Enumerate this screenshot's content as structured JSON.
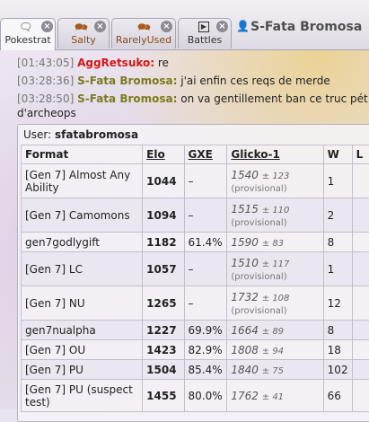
{
  "tabs": [
    {
      "label": "Pokestrat",
      "icon": "chat-bubble-icon"
    },
    {
      "label": "Salty",
      "icon": "chat-bubbles-icon"
    },
    {
      "label": "RarelyUsed",
      "icon": "chat-bubbles-icon"
    },
    {
      "label": "Battles",
      "icon": "battle-icon"
    }
  ],
  "close_label": "×",
  "user": {
    "name": "S-Fata Bromosa"
  },
  "chat": [
    {
      "time": "[01:43:05]",
      "nick": "AggRetsuko:",
      "text": "re"
    },
    {
      "time": "[03:28:36]",
      "nick": "S-Fata Bromosa:",
      "text": "j'ai enfin ces reqs de merde"
    },
    {
      "time": "[03:28:50]",
      "nick": "S-Fata Bromosa:",
      "text": "on va gentillement ban ce truc pét",
      "continuation": "d'archeops"
    }
  ],
  "panel": {
    "user_label": "User:",
    "user_value": "sfatabromosa",
    "headers": [
      "Format",
      "Elo",
      "GXE",
      "Glicko-1",
      "W",
      "L"
    ],
    "rows": [
      {
        "format": "[Gen 7] Almost Any Ability",
        "elo": "1044",
        "gxe": "–",
        "glicko": "1540",
        "pm": "± 123",
        "prov": "(provisional)",
        "w": "1"
      },
      {
        "format": "[Gen 7] Camomons",
        "elo": "1094",
        "gxe": "–",
        "glicko": "1515",
        "pm": "± 110",
        "prov": "(provisional)",
        "w": "2"
      },
      {
        "format": "gen7godlygift",
        "elo": "1182",
        "gxe": "61.4%",
        "glicko": "1590",
        "pm": "± 83",
        "prov": "",
        "w": "8"
      },
      {
        "format": "[Gen 7] LC",
        "elo": "1057",
        "gxe": "–",
        "glicko": "1510",
        "pm": "± 117",
        "prov": "(provisional)",
        "w": "1"
      },
      {
        "format": "[Gen 7] NU",
        "elo": "1265",
        "gxe": "–",
        "glicko": "1732",
        "pm": "± 108",
        "prov": "(provisional)",
        "w": "12"
      },
      {
        "format": "gen7nualpha",
        "elo": "1227",
        "gxe": "69.9%",
        "glicko": "1664",
        "pm": "± 89",
        "prov": "",
        "w": "8"
      },
      {
        "format": "[Gen 7] OU",
        "elo": "1423",
        "gxe": "82.9%",
        "glicko": "1808",
        "pm": "± 94",
        "prov": "",
        "w": "18"
      },
      {
        "format": "[Gen 7] PU",
        "elo": "1504",
        "gxe": "85.4%",
        "glicko": "1840",
        "pm": "± 75",
        "prov": "",
        "w": "102"
      },
      {
        "format": "[Gen 7] PU (suspect test)",
        "elo": "1455",
        "gxe": "80.0%",
        "glicko": "1762",
        "pm": "± 41",
        "prov": "",
        "w": "66"
      }
    ]
  }
}
